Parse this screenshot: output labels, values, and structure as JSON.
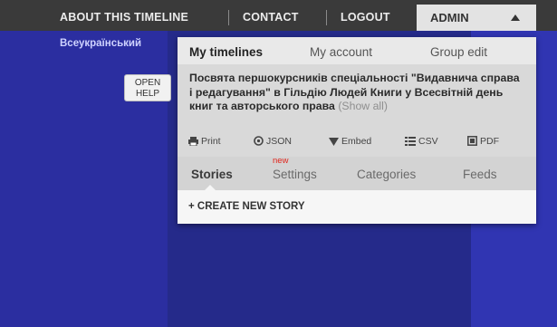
{
  "topnav": {
    "about": "ABOUT THIS TIMELINE",
    "contact": "CONTACT",
    "logout": "LOGOUT",
    "admin": "ADMIN"
  },
  "page": {
    "site_title": "Всеукраїнський",
    "open_help": [
      "OPEN",
      "HELP"
    ]
  },
  "panel": {
    "tabs": [
      "My timelines",
      "My account",
      "Group edit"
    ],
    "active_tab": "My timelines",
    "timeline_title": "Посвята першокурсників спеціальності \"Видавнича справа і редагування\" в Гільдію Людей Книги у Всесвітній день книг та авторського права",
    "show_all": "(Show all)",
    "actions": [
      {
        "label": "Print",
        "icon": "printer-icon"
      },
      {
        "label": "JSON",
        "icon": "json-icon"
      },
      {
        "label": "Embed",
        "icon": "embed-icon"
      },
      {
        "label": "CSV",
        "icon": "csv-icon"
      },
      {
        "label": "PDF",
        "icon": "pdf-icon"
      }
    ],
    "subtabs": [
      "Stories",
      "Settings",
      "Categories",
      "Feeds"
    ],
    "active_subtab": "Stories",
    "new_badge": "new",
    "create_story": "+ CREATE NEW STORY"
  }
}
